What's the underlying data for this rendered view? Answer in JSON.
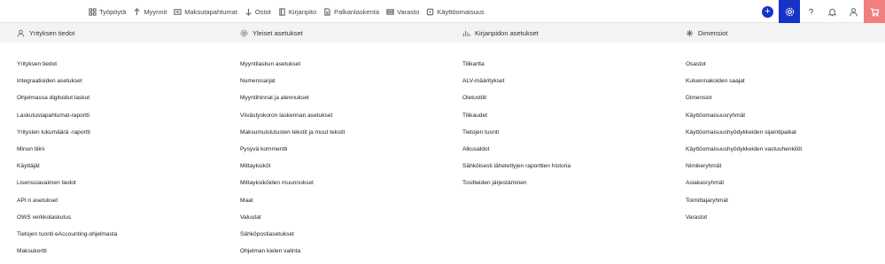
{
  "nav": {
    "items": [
      {
        "label": "Työpöytä",
        "icon": "dashboard-icon"
      },
      {
        "label": "Myynnit",
        "icon": "arrow-up-icon"
      },
      {
        "label": "Maksutapahtumat",
        "icon": "bank-transactions-icon"
      },
      {
        "label": "Ostot",
        "icon": "arrow-down-icon"
      },
      {
        "label": "Kirjanpito",
        "icon": "book-icon"
      },
      {
        "label": "Palkanlaskenta",
        "icon": "payroll-icon"
      },
      {
        "label": "Varasto",
        "icon": "warehouse-icon"
      },
      {
        "label": "Käyttöomaisuus",
        "icon": "fixed-assets-icon"
      }
    ],
    "add_label": "+"
  },
  "columns": [
    {
      "heading": "Yrityksen tiedot",
      "icon": "user-icon",
      "links": [
        "Yrityksen tiedot",
        "Integraatioiden asetukset",
        "Ohjelmassa digitoidut laskut",
        "Laskutustapahtumat-raportti",
        "Yritysten lukumäärä -raportti",
        "Minun tilini",
        "Käyttäjät",
        "Lisenssiavaimen tiedot",
        "API:n asetukset",
        "OWS verkkolaskutus",
        "Tietojen tuonti eAccounting-ohjelmasta",
        "Maksukortti"
      ]
    },
    {
      "heading": "Yleiset asetukset",
      "icon": "gear-icon",
      "links": [
        "Myyntilaskun asetukset",
        "Numerosarjat",
        "Myyntihinnat ja alennukset",
        "Viivästyskoron laskennan asetukset",
        "Maksumuistutusten tekstit ja muut tekstit",
        "Pysyvä kommentti",
        "Mittayksiköt",
        "Mittayksiköiden muunnokset",
        "Maat",
        "Valuutat",
        "Sähköpostiasetukset",
        "Ohjelman kielen valinta"
      ]
    },
    {
      "heading": "Kirjanpidon asetukset",
      "icon": "bar-chart-icon",
      "links": [
        "Tilikartta",
        "ALV-määritykset",
        "Oletustilit",
        "Tilikaudet",
        "Tietojen tuonti",
        "Alkusaldot",
        "Sähköisesti lähetettyjen raporttien historia",
        "Tositteiden järjestäminen"
      ]
    },
    {
      "heading": "Dimensiot",
      "icon": "dimensions-icon",
      "links": [
        "Osastot",
        "Kuluennakoiden saajat",
        "Dimensiot",
        "Käyttöomaisuusryhmät",
        "Käyttöomaisuushyödykkeiden sijaintipaikat",
        "Käyttöomaisuushyödykkeiden vastuuhenkilöt",
        "Nimikeryhmät",
        "Asiakasryhmät",
        "Toimittajaryhmät",
        "Varastot"
      ]
    }
  ]
}
